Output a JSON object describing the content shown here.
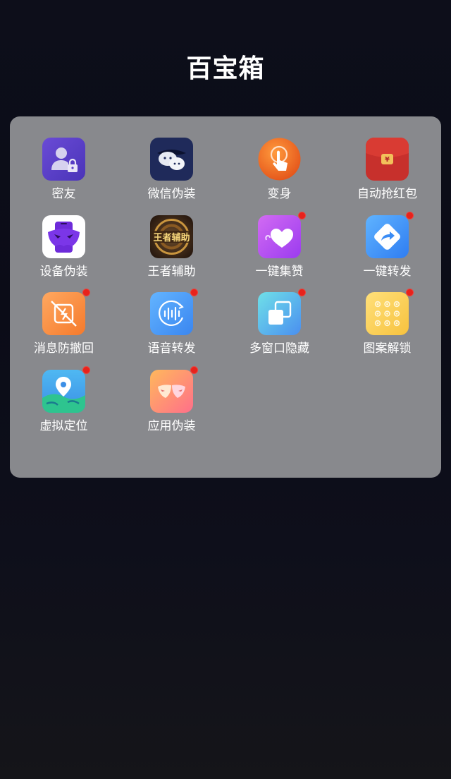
{
  "header": {
    "title": "百宝箱"
  },
  "apps": [
    {
      "label": "密友",
      "icon": "user-lock-icon",
      "badge": false
    },
    {
      "label": "微信伪装",
      "icon": "wechat-disguise-icon",
      "badge": false
    },
    {
      "label": "变身",
      "icon": "touch-finger-icon",
      "badge": false
    },
    {
      "label": "自动抢红包",
      "icon": "red-envelope-icon",
      "badge": false
    },
    {
      "label": "设备伪装",
      "icon": "mask-phone-icon",
      "badge": false
    },
    {
      "label": "王者辅助",
      "icon": "game-assist-icon",
      "badge": false
    },
    {
      "label": "一键集赞",
      "icon": "heart-like-icon",
      "badge": true
    },
    {
      "label": "一键转发",
      "icon": "forward-arrow-icon",
      "badge": true
    },
    {
      "label": "消息防撤回",
      "icon": "no-recall-icon",
      "badge": true
    },
    {
      "label": "语音转发",
      "icon": "voice-wave-icon",
      "badge": true
    },
    {
      "label": "多窗口隐藏",
      "icon": "multi-window-icon",
      "badge": true
    },
    {
      "label": "图案解锁",
      "icon": "pattern-unlock-icon",
      "badge": true
    },
    {
      "label": "虚拟定位",
      "icon": "location-pin-icon",
      "badge": true
    },
    {
      "label": "应用伪装",
      "icon": "app-mask-icon",
      "badge": true
    }
  ],
  "icon_text": {
    "game_assist": "王者辅助"
  },
  "colors": {
    "panel": "#88898d",
    "badge": "#e8221b",
    "background": "#0d0e1a"
  }
}
